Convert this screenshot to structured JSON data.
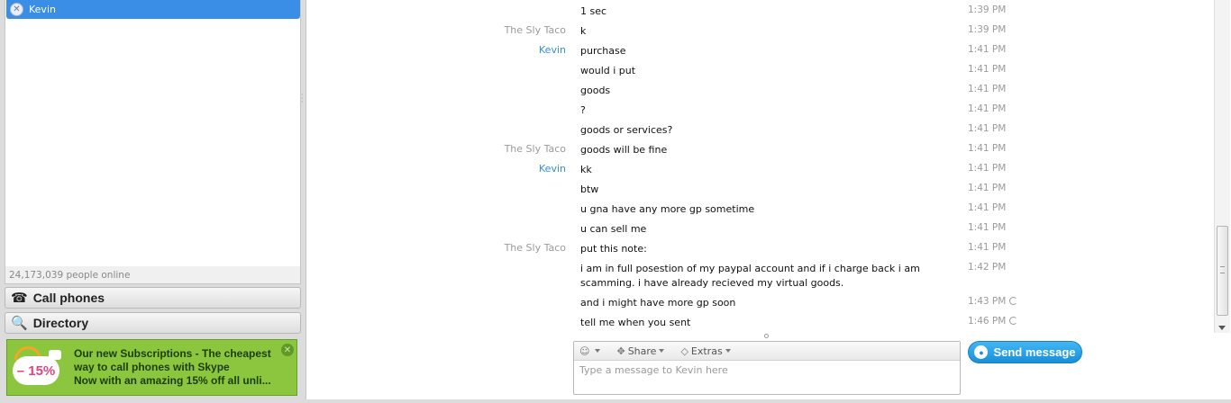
{
  "contacts": {
    "selected": {
      "name": "Kevin"
    },
    "online_count": "24,173,039 people online"
  },
  "nav": {
    "call_phones": "Call phones",
    "directory": "Directory"
  },
  "ad": {
    "badge": "– 15%",
    "line1": "Our new Subscriptions - The cheapest",
    "line2": "way to call phones with Skype",
    "line3": "Now with an amazing 15% off all unli..."
  },
  "messages": [
    {
      "sender": "",
      "text": "1 sec",
      "time": "1:39 PM"
    },
    {
      "sender": "The Sly Taco",
      "text": "k",
      "time": "1:39 PM"
    },
    {
      "sender": "Kevin",
      "text": "purchase",
      "time": "1:41 PM"
    },
    {
      "sender": "",
      "text": "would i put",
      "time": "1:41 PM"
    },
    {
      "sender": "",
      "text": "goods",
      "time": "1:41 PM"
    },
    {
      "sender": "",
      "text": "?",
      "time": "1:41 PM"
    },
    {
      "sender": "",
      "text": "goods or services?",
      "time": "1:41 PM"
    },
    {
      "sender": "The Sly Taco",
      "text": "goods will be fine",
      "time": "1:41 PM"
    },
    {
      "sender": "Kevin",
      "text": "kk",
      "time": "1:41 PM"
    },
    {
      "sender": "",
      "text": "btw",
      "time": "1:41 PM"
    },
    {
      "sender": "",
      "text": "u gna have any more gp sometime",
      "time": "1:41 PM"
    },
    {
      "sender": "",
      "text": "u can sell me",
      "time": "1:41 PM"
    },
    {
      "sender": "The Sly Taco",
      "text": "put this note:",
      "time": "1:41 PM"
    },
    {
      "sender": "",
      "text": "i am in full posestion of my paypal account and if i charge back i am scamming. i have already recieved my virtual goods.",
      "time": "1:42 PM"
    },
    {
      "sender": "",
      "text": "and i might have more gp soon",
      "time": "1:43 PM",
      "pending": true
    },
    {
      "sender": "",
      "text": "tell me when you sent",
      "time": "1:46 PM",
      "pending": true
    }
  ],
  "compose": {
    "emoticon_icon": "smiley-icon",
    "share_label": "Share",
    "extras_label": "Extras",
    "placeholder": "Type a message to Kevin here"
  },
  "send_button": {
    "label": "Send message"
  },
  "colors": {
    "selection_blue": "#3b8ee6",
    "ad_green": "#8cc63f",
    "send_blue": "#1a8fd8",
    "kevin_name": "#2d8fe0"
  }
}
